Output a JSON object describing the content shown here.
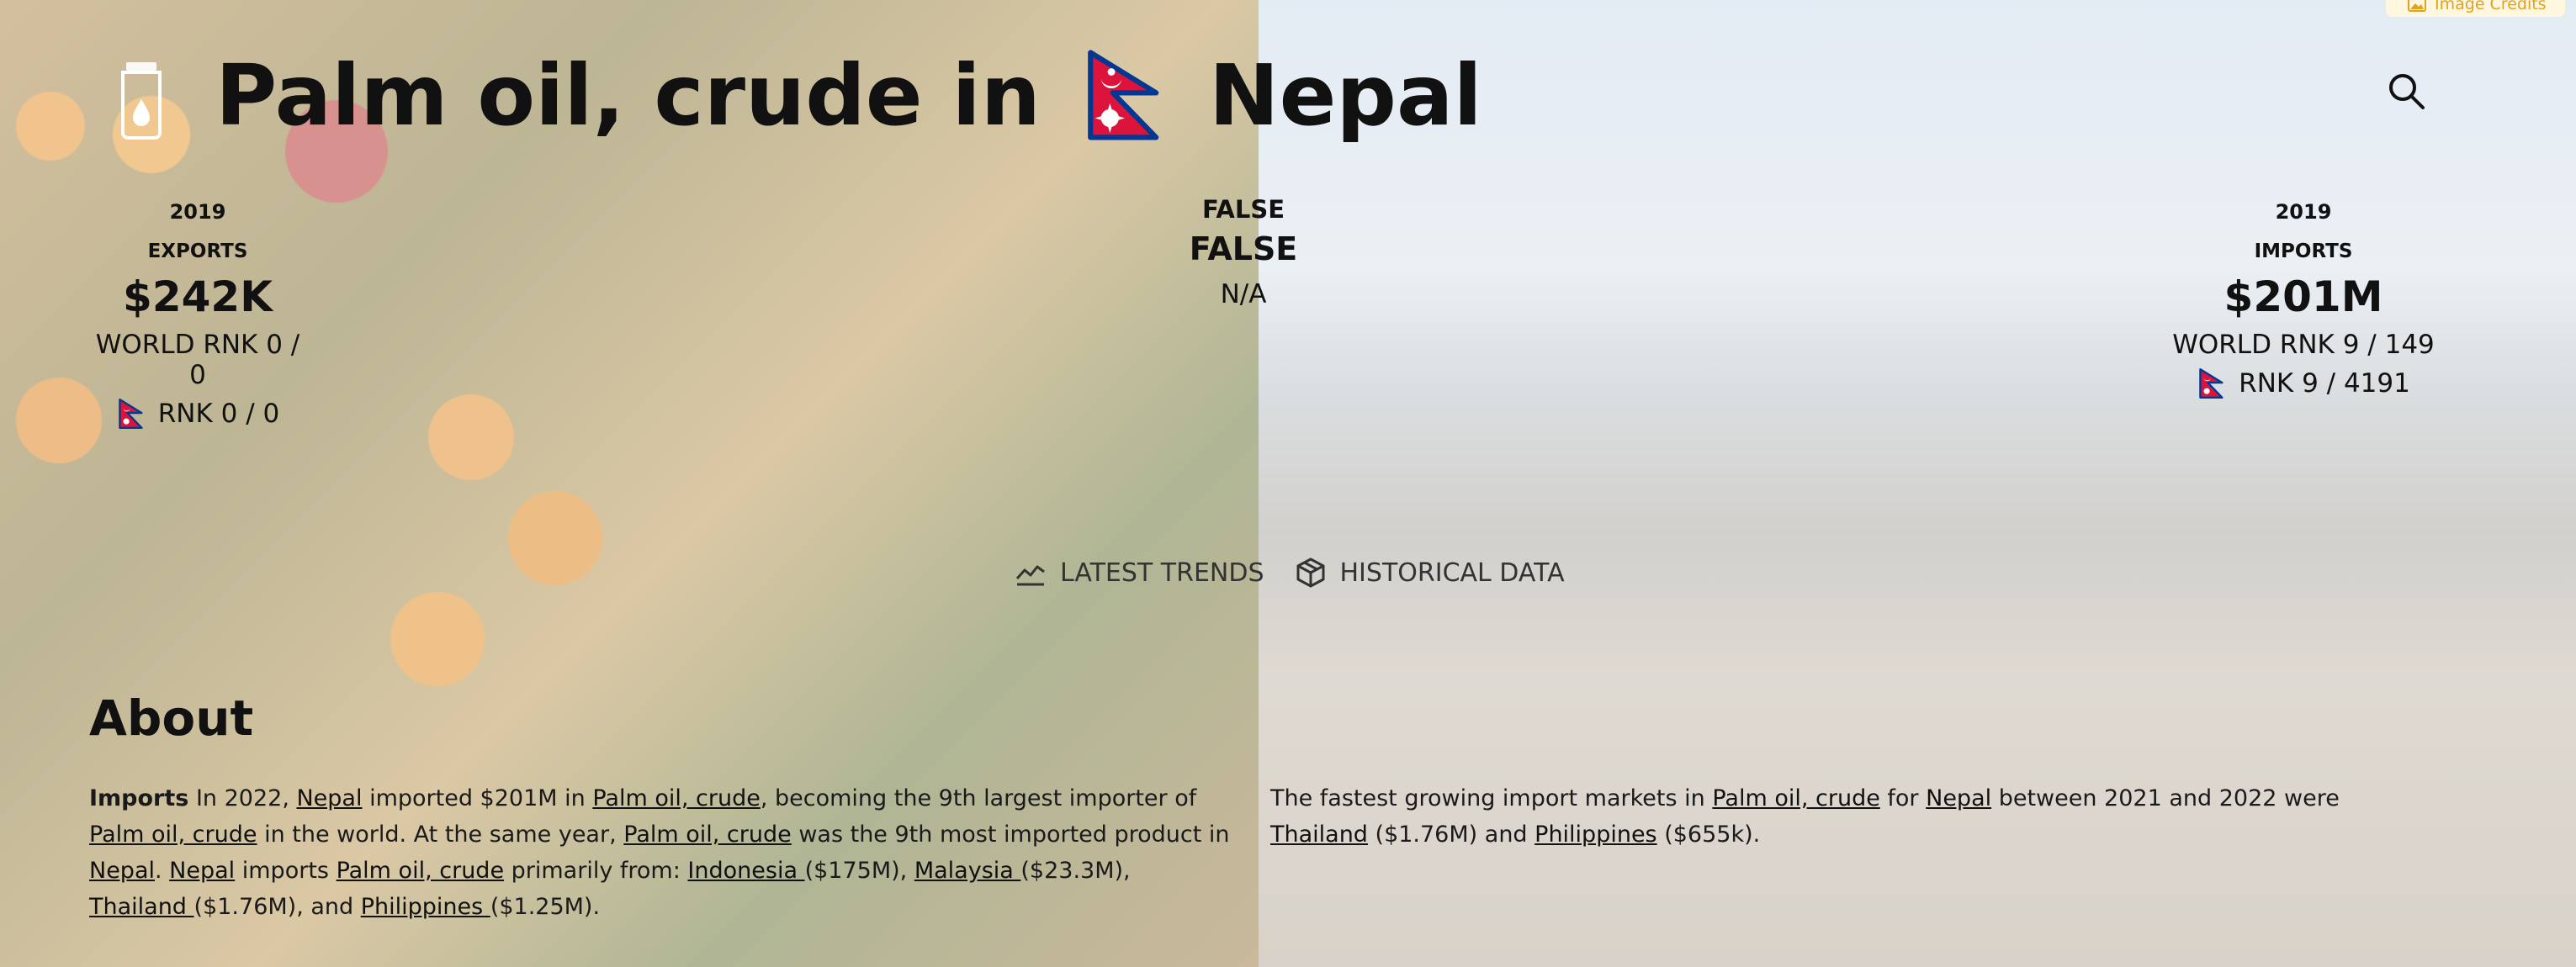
{
  "header": {
    "title_prefix": "Palm oil, crude in",
    "country": "Nepal"
  },
  "credits": {
    "label": "Image Credits"
  },
  "exports": {
    "year": "2019",
    "kind": "EXPORTS",
    "value": "$242K",
    "world_rank": "WORLD RNK 0 / 0",
    "country_rank": "RNK 0 / 0"
  },
  "middle": {
    "line1": "FALSE",
    "line2": "FALSE",
    "line3": "N/A"
  },
  "imports": {
    "year": "2019",
    "kind": "IMPORTS",
    "value": "$201M",
    "world_rank": "WORLD RNK 9 / 149",
    "country_rank": "RNK 9 / 4191"
  },
  "tabs": [
    {
      "label": "LATEST TRENDS",
      "icon": "trend-line-icon"
    },
    {
      "label": "HISTORICAL DATA",
      "icon": "cube-icon"
    }
  ],
  "about": {
    "title": "About",
    "left": {
      "lead": "Imports",
      "t1": " In 2022, ",
      "l_nepal1": "Nepal",
      "t2": " imported $201M in ",
      "l_product1": "Palm oil, crude",
      "t3": ", becoming the 9th largest importer of ",
      "l_product2": "Palm oil, crude",
      "t4": " in the world. At the same year, ",
      "l_product3": "Palm oil, crude",
      "t5": " was the 9th most imported product in ",
      "l_nepal2": "Nepal",
      "t6": ". ",
      "l_nepal3": "Nepal",
      "t7": " imports ",
      "l_product4": "Palm oil, crude",
      "t8": " primarily from: ",
      "l_indonesia": "Indonesia ",
      "t9": "($175M), ",
      "l_malaysia": "Malaysia ",
      "t10": "($23.3M), ",
      "l_thailand": "Thailand ",
      "t11": "($1.76M), and ",
      "l_philippines": "Philippines ",
      "t12": "($1.25M)."
    },
    "right": {
      "t1": "The fastest growing import markets in ",
      "l_product": "Palm oil, crude",
      "t2": " for ",
      "l_nepal": "Nepal",
      "t3": " between 2021 and 2022 were ",
      "l_thailand": "Thailand",
      "t4": " ($1.76M) and ",
      "l_philippines": "Philippines",
      "t5": " ($655k)."
    }
  },
  "colors": {
    "flag_red": "#dc143c",
    "flag_blue": "#003893",
    "credits_text": "#e3a21a"
  }
}
